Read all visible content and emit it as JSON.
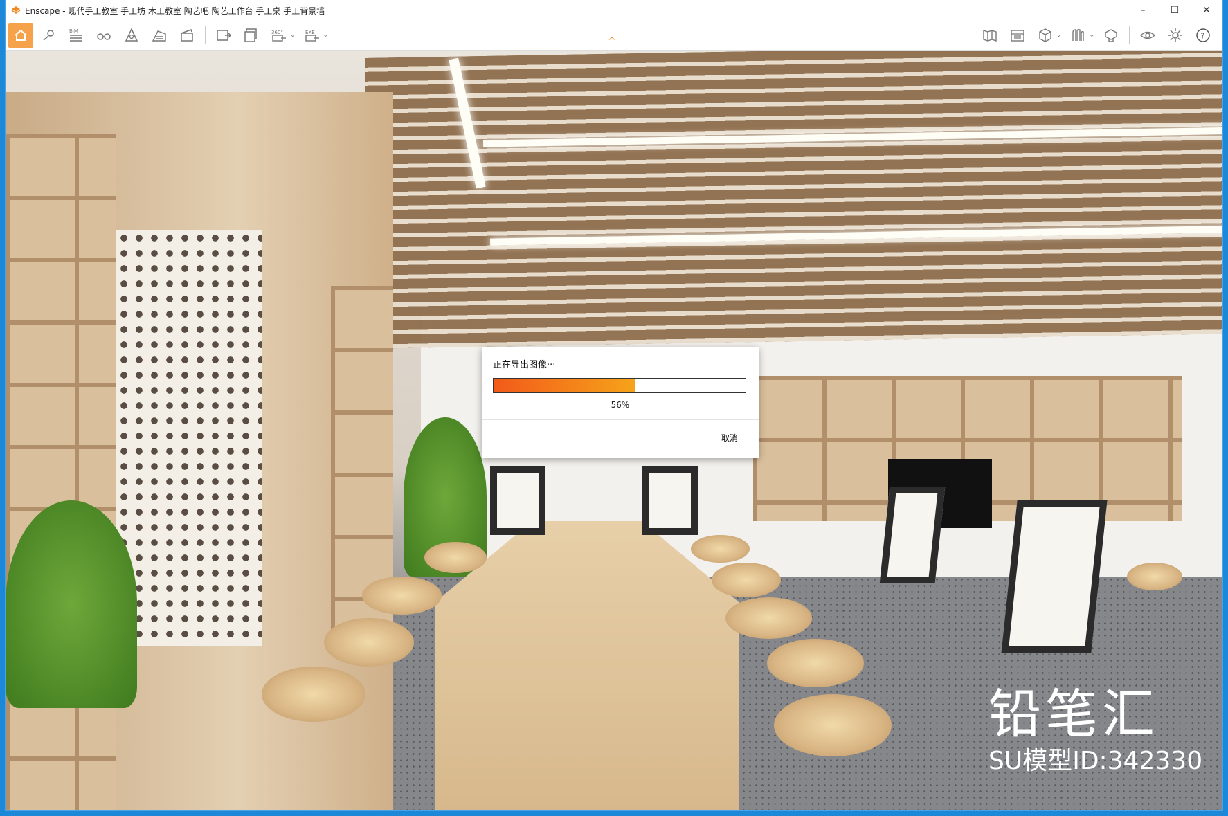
{
  "window": {
    "title": "Enscape - 现代手工教室 手工坊 木工教室 陶艺吧 陶艺工作台 手工桌 手工背景墙",
    "controls": {
      "minimize": "–",
      "maximize": "☐",
      "close": "✕"
    }
  },
  "toolbar": {
    "bim_label": "BIM",
    "pano_label": "360°",
    "exe_label": "EXE",
    "left_icons": [
      "home-icon",
      "map-pin-icon",
      "bim-list-icon",
      "binoculars-icon",
      "archive-icon",
      "building-icon",
      "clapper-icon"
    ],
    "export_icons": [
      "screenshot-export-icon",
      "batch-export-icon",
      "panorama-export-icon",
      "exe-export-icon"
    ],
    "right_icons": [
      "book-icon",
      "library-icon",
      "cube-icon",
      "asset-icon",
      "settings-panel-icon",
      "eye-icon",
      "gear-icon",
      "help-icon"
    ],
    "chevron": "⌄",
    "collapse_arrow": "^",
    "help_glyph": "?"
  },
  "dialog": {
    "title": "正在导出图像···",
    "progress_percent": 56,
    "progress_text": "56%",
    "cancel_label": "取消"
  },
  "watermark": {
    "brand": "铅笔汇",
    "model_id": "SU模型ID:342330"
  },
  "colors": {
    "accent": "#f6a24a",
    "progress_start": "#f25a1a",
    "progress_end": "#f6a31a",
    "desktop": "#1e88d8"
  }
}
